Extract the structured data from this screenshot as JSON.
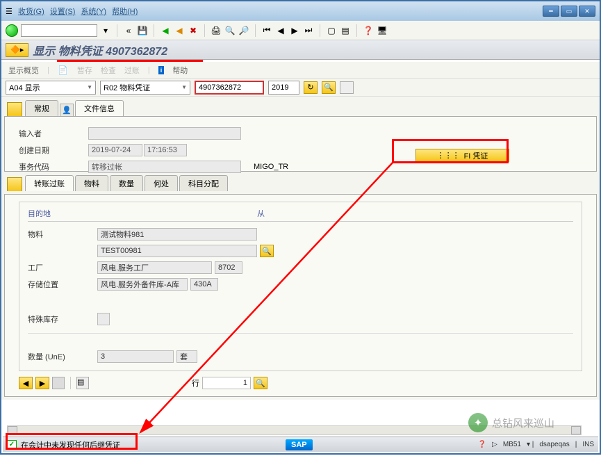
{
  "menu": {
    "shouhuo": "收货(G)",
    "shezhi": "设置(S)",
    "xitong": "系统(Y)",
    "bangzhu": "帮助(H)",
    "icon": "☰"
  },
  "page_title": "显示 物料凭证 4907362872",
  "subbar": {
    "xsgz": "显示概览",
    "zancun": "暂存",
    "jiancha": "检查",
    "guozhang": "过账",
    "bangzhu": "帮助"
  },
  "filters": {
    "combo1": "A04 显示",
    "combo2": "R02 物料凭证",
    "doc_no": "4907362872",
    "year": "2019"
  },
  "upper_tabs": {
    "tab1": "常规",
    "tab2": "文件信息"
  },
  "upper_form": {
    "entered_by_label": "输入者",
    "entered_by": "",
    "create_date_label": "创建日期",
    "create_date": "2019-07-24",
    "create_time": "17:16:53",
    "tcode_label": "事务代码",
    "tcode_text": "转移过帐",
    "tcode_code": "MIGO_TR",
    "fi_button": "FI 凭证"
  },
  "lower_tabs": {
    "t1": "转账过账",
    "t2": "物料",
    "t3": "数量",
    "t4": "何处",
    "t5": "科目分配"
  },
  "dest": {
    "head_left": "目的地",
    "head_right": "从",
    "material_label": "物料",
    "material": "测试物料981",
    "material_code": "TEST00981",
    "plant_label": "工厂",
    "plant": "风电.服务工厂",
    "plant_code": "8702",
    "sloc_label": "存储位置",
    "sloc": "风电.服务外备件库-A库",
    "sloc_code": "430A",
    "special_label": "特殊库存",
    "qty_label": "数量 (UnE)",
    "qty": "3",
    "unit": "套",
    "line_label": "行",
    "line_no": "1"
  },
  "status": {
    "message": "在会计中未发现任何后继凭证",
    "sap": "SAP",
    "field1": "MB51",
    "field2": "dsapeqas",
    "field3": "INS"
  },
  "watermark": "总钻风来巡山"
}
